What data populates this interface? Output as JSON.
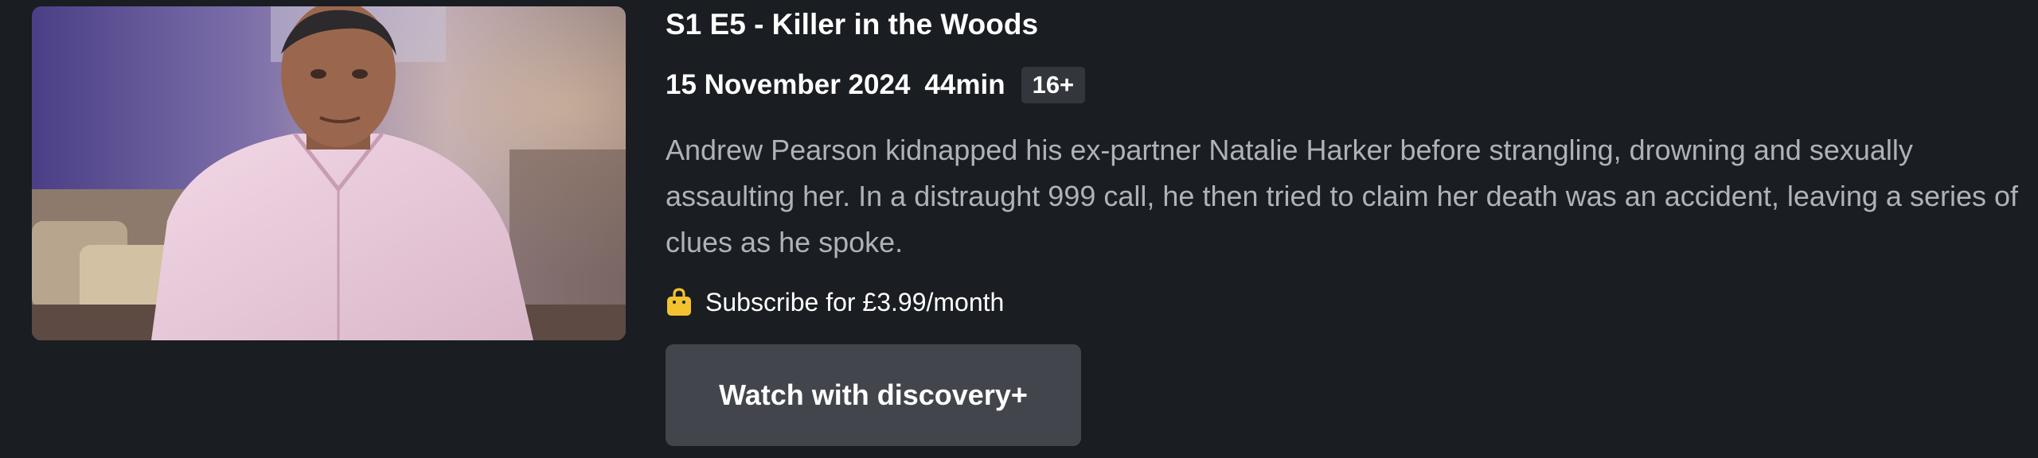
{
  "episode": {
    "title": "S1 E5 - Killer in the Woods",
    "release_date": "15 November 2024",
    "duration": "44min",
    "age_rating": "16+",
    "synopsis": "Andrew Pearson kidnapped his ex-partner Natalie Harker before strangling, drowning and sexually assaulting her. In a distraught 999 call, he then tried to claim her death was an accident, leaving a series of clues as he spoke."
  },
  "offer": {
    "icon": "shopping-bag-icon",
    "icon_color": "#f2c230",
    "text": "Subscribe for £3.99/month"
  },
  "watch_button": {
    "label": "Watch with discovery+"
  },
  "colors": {
    "background": "#1a1d21",
    "title": "#ffffff",
    "synopsis": "#aeb3b9",
    "badge_bg": "#33373d",
    "button_bg": "#42464c"
  }
}
